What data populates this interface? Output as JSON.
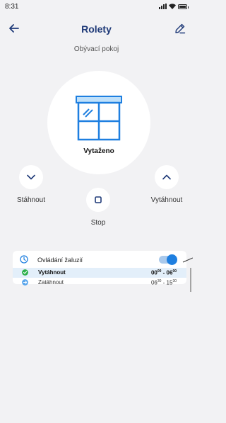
{
  "status_bar": {
    "time": "8:31"
  },
  "nav": {
    "title": "Rolety"
  },
  "subtitle": "Obývací pokoj",
  "state": {
    "label": "Vytaženo"
  },
  "controls": {
    "down_label": "Stáhnout",
    "stop_label": "Stop",
    "up_label": "Vytáhnout"
  },
  "schedule": {
    "title": "Ovládání žaluzií",
    "enabled": true,
    "rows": [
      {
        "name": "Vytáhnout",
        "from_h": "00",
        "from_m": "00",
        "sep": " - ",
        "to_h": "06",
        "to_m": "00",
        "status": "done"
      },
      {
        "name": "Zatáhnout",
        "from_h": "06",
        "from_m": "30",
        "sep": " - ",
        "to_h": "15",
        "to_m": "30",
        "status": "pending"
      }
    ]
  },
  "colors": {
    "accent": "#1e7fe0",
    "title": "#1f3a78",
    "success": "#2db04a",
    "background": "#f2f2f4"
  }
}
